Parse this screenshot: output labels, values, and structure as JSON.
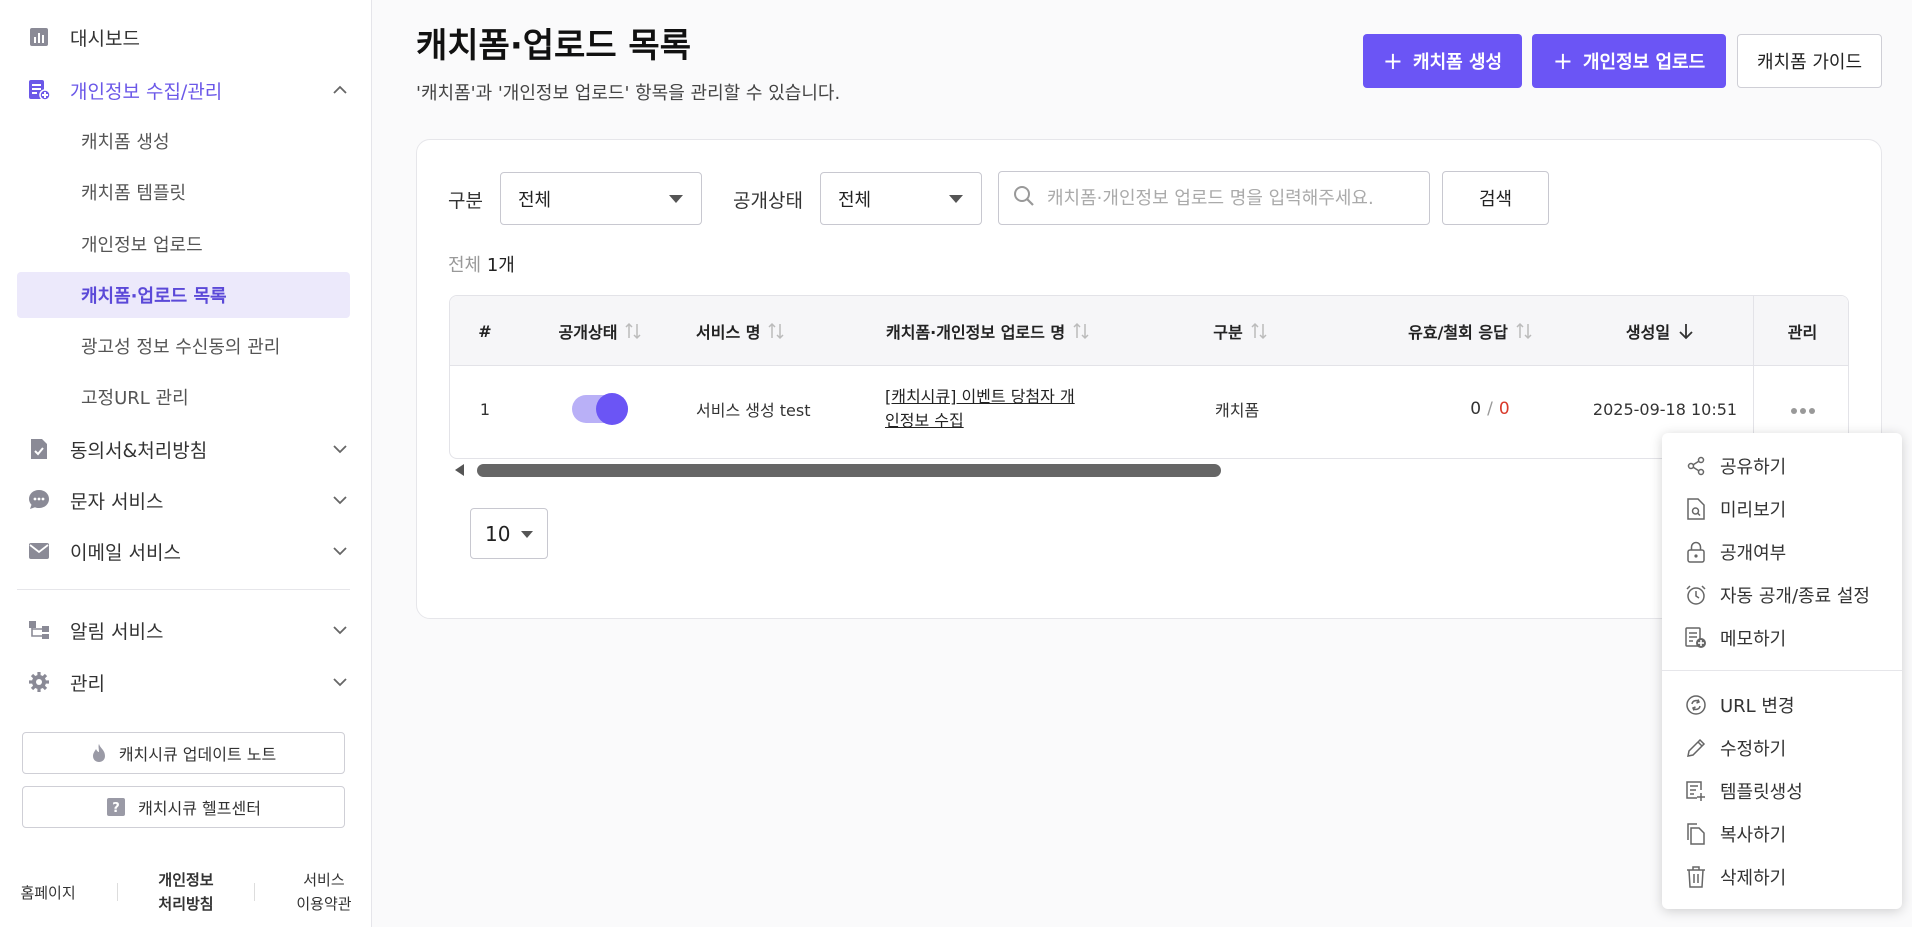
{
  "sidebar": {
    "nav": {
      "dashboard": "대시보드",
      "privacy_collect": "개인정보 수집/관리",
      "consent": "동의서&처리방침",
      "sms": "문자 서비스",
      "email": "이메일 서비스",
      "alimtalk": "알림 서비스",
      "admin": "관리"
    },
    "sub_items": [
      "캐치폼 생성",
      "캐치폼 템플릿",
      "개인정보 업로드",
      "캐치폼·업로드 목록",
      "광고성 정보 수신동의 관리",
      "고정URL 관리"
    ],
    "update_note": "캐치시큐 업데이트 노트",
    "help_center": "캐치시큐 헬프센터",
    "footer": {
      "home": "홈페이지",
      "privacy_policy_1": "개인정보",
      "privacy_policy_2": "처리방침",
      "terms_1": "서비스",
      "terms_2": "이용약관"
    }
  },
  "header": {
    "title": "캐치폼·업로드 목록",
    "description": "'캐치폼'과 '개인정보 업로드' 항목을 관리할 수 있습니다.",
    "create_button": "캐치폼 생성",
    "upload_button": "개인정보 업로드",
    "guide_button": "캐치폼 가이드"
  },
  "filters": {
    "category_label": "구분",
    "category_value": "전체",
    "status_label": "공개상태",
    "status_value": "전체",
    "search_placeholder": "캐치폼·개인정보 업로드 명을 입력해주세요.",
    "search_button": "검색"
  },
  "count": {
    "prefix": "전체",
    "value": "1개"
  },
  "table": {
    "headers": {
      "num": "#",
      "status": "공개상태",
      "service": "서비스 명",
      "name": "캐치폼·개인정보 업로드 명",
      "category": "구분",
      "responses": "유효/철회 응답",
      "created": "생성일",
      "manage": "관리"
    },
    "rows": [
      {
        "num": "1",
        "status_on": true,
        "service": "서비스 생성 test",
        "name_1": "[캐치시큐] 이벤트 당첨자 개",
        "name_2": "인정보 수집",
        "category": "캐치폼",
        "valid": "0",
        "slash": "/",
        "withdrawn": "0",
        "created": "2025-09-18 10:51"
      }
    ]
  },
  "page_size": "10",
  "menu": {
    "share": "공유하기",
    "preview": "미리보기",
    "visibility": "공개여부",
    "auto_schedule": "자동 공개/종료 설정",
    "memo": "메모하기",
    "change_url": "URL 변경",
    "edit": "수정하기",
    "make_template": "템플릿생성",
    "copy": "복사하기",
    "delete": "삭제하기"
  },
  "colors": {
    "accent": "#6b55f5",
    "withdrawn": "#d93a2b"
  }
}
